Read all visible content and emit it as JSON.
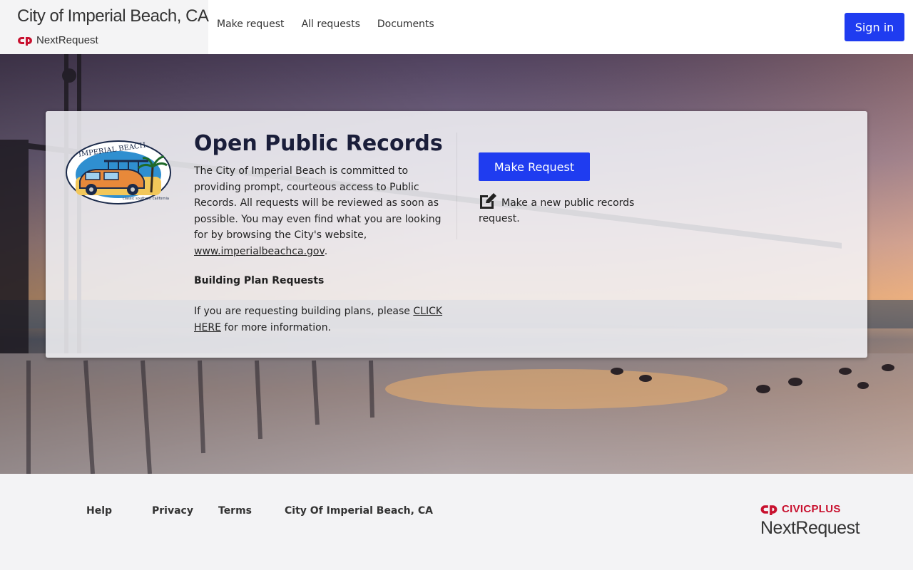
{
  "header": {
    "city_title": "City of Imperial Beach, CA",
    "product_name": "NextRequest",
    "nav": [
      "Make request",
      "All requests",
      "Documents"
    ],
    "sign_in": "Sign in"
  },
  "card": {
    "title": "Open Public Records",
    "intro_before_link": "The City of Imperial Beach is committed to providing prompt, courteous access to Public Records. All requests will be reviewed as soon as possible. You may even find what you are looking for by browsing the City's website, ",
    "intro_link": "www.imperialbeachca.gov",
    "intro_after_link": ".",
    "plans_heading": "Building Plan Requests",
    "plans_before_link": "If you are requesting building plans, please ",
    "plans_link": "CLICK HERE",
    "plans_after_link": " for more information.",
    "make_request_button": "Make Request",
    "make_request_desc": "Make a new public records request.",
    "logo_text_top": "IMPERIAL BEACH",
    "logo_text_bottom": "classic southern california"
  },
  "footer": {
    "links": [
      "Help",
      "Privacy",
      "Terms",
      "City Of Imperial Beach, CA"
    ],
    "brand_top": "CIVICPLUS",
    "brand_bottom": "NextRequest"
  },
  "colors": {
    "primary": "#1f3cf0",
    "brand_red": "#c8102e",
    "title_navy": "#1a1e3a"
  }
}
